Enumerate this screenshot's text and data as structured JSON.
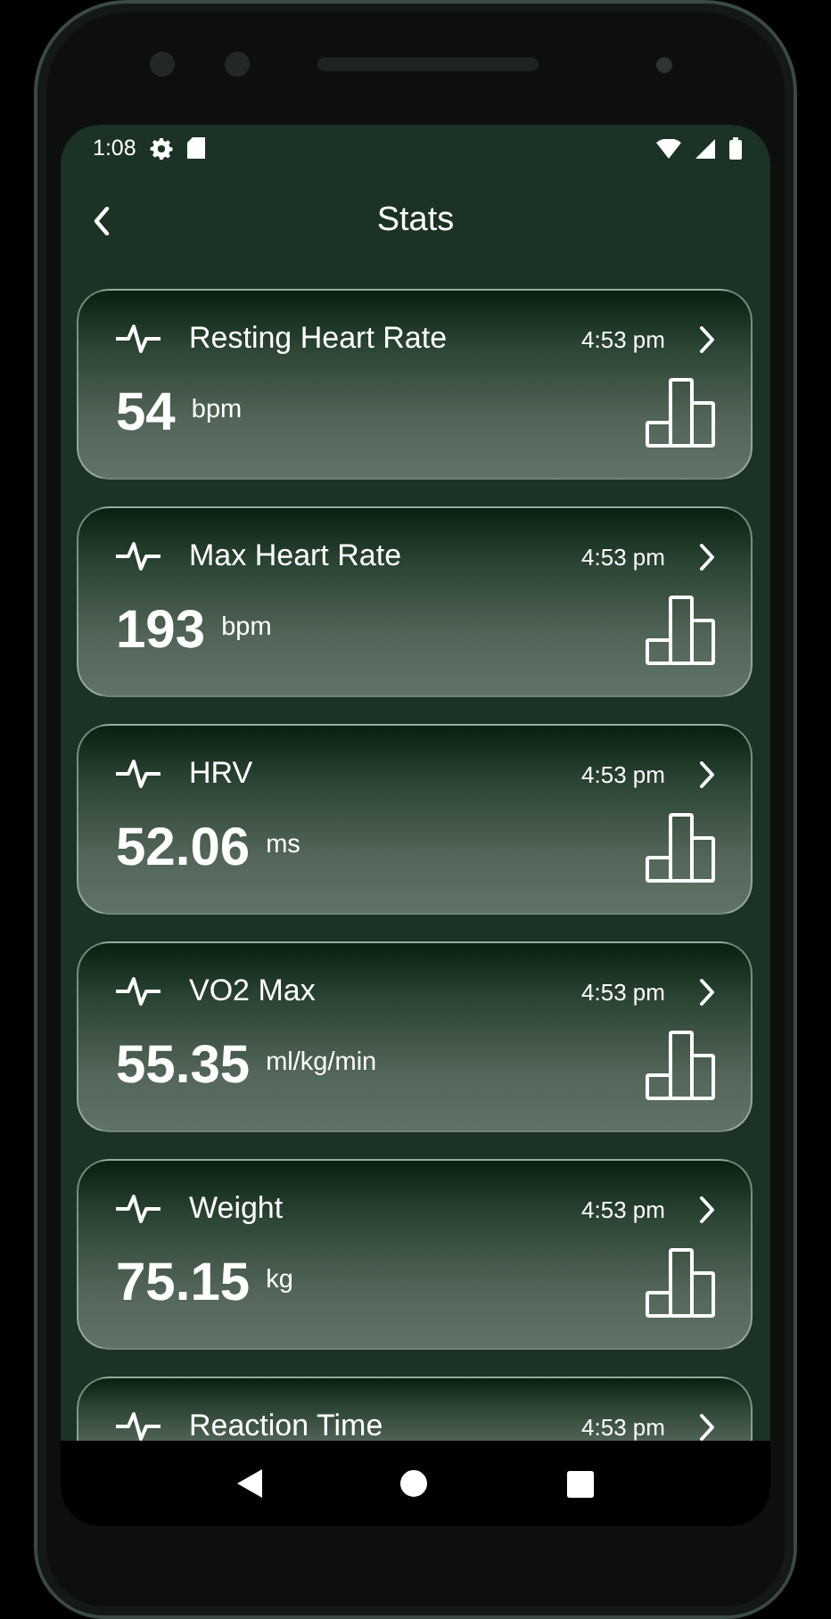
{
  "status_bar": {
    "time": "1:08"
  },
  "header": {
    "title": "Stats"
  },
  "stats": [
    {
      "title": "Resting Heart Rate",
      "time": "4:53 pm",
      "value": "54",
      "unit": "bpm"
    },
    {
      "title": "Max Heart Rate",
      "time": "4:53 pm",
      "value": "193",
      "unit": "bpm"
    },
    {
      "title": "HRV",
      "time": "4:53 pm",
      "value": "52.06",
      "unit": "ms"
    },
    {
      "title": "VO2 Max",
      "time": "4:53 pm",
      "value": "55.35",
      "unit": "ml/kg/min"
    },
    {
      "title": "Weight",
      "time": "4:53 pm",
      "value": "75.15",
      "unit": "kg"
    },
    {
      "title": "Reaction Time",
      "time": "4:53 pm"
    }
  ]
}
